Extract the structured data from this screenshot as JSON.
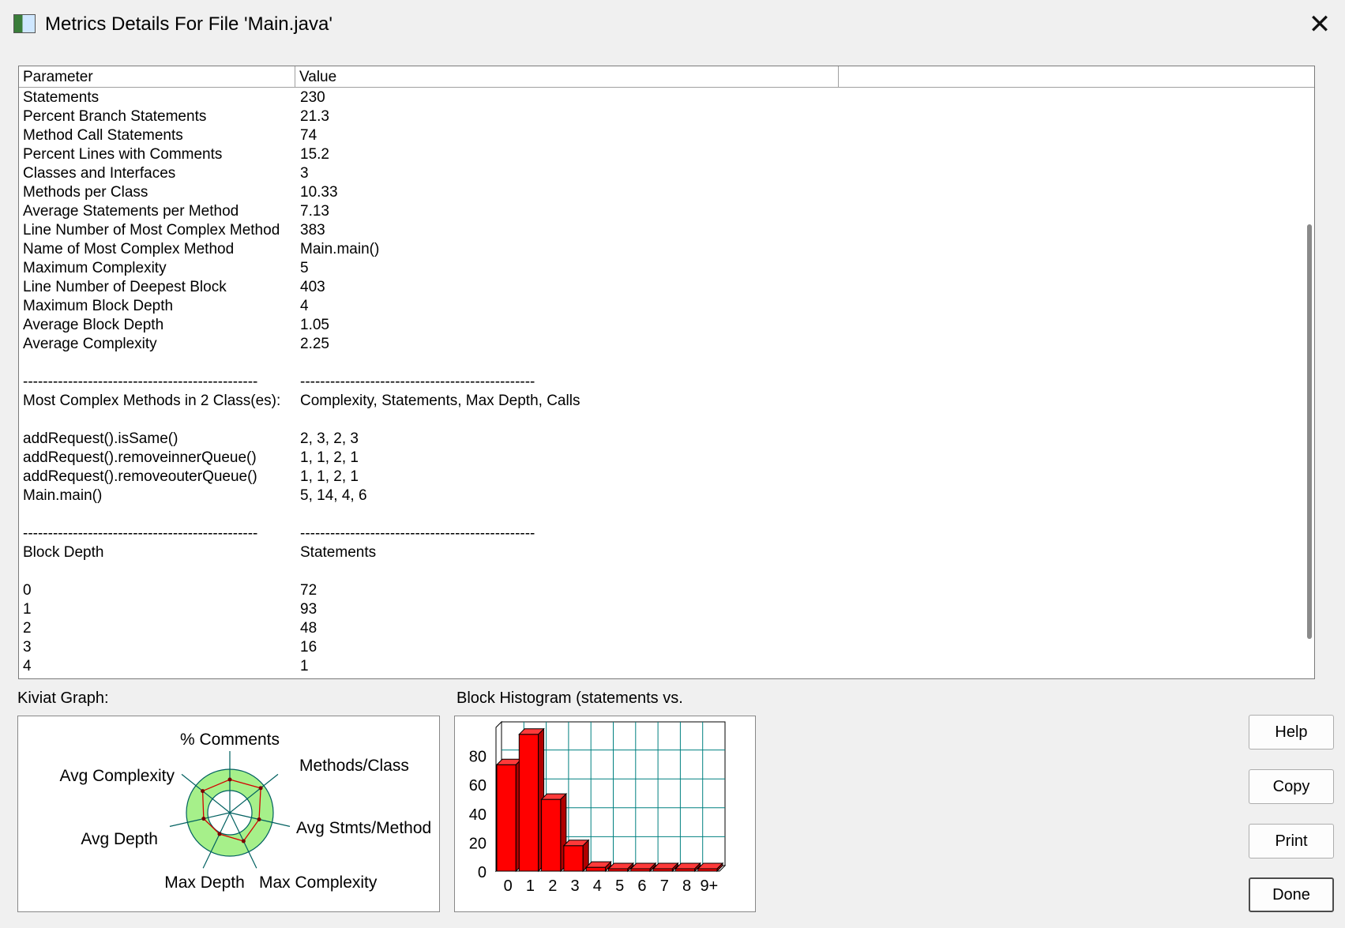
{
  "window": {
    "title": "Metrics Details For File 'Main.java'",
    "close_glyph": "✕"
  },
  "table": {
    "columns": [
      "Parameter",
      "Value",
      ""
    ],
    "rows": [
      [
        "Statements",
        "230"
      ],
      [
        "Percent Branch Statements",
        "21.3"
      ],
      [
        "Method Call Statements",
        "74"
      ],
      [
        "Percent Lines with Comments",
        "15.2"
      ],
      [
        "Classes and Interfaces",
        "3"
      ],
      [
        "Methods per Class",
        "10.33"
      ],
      [
        "Average Statements per Method",
        "7.13"
      ],
      [
        "Line Number of Most Complex Method",
        "383"
      ],
      [
        "Name of Most Complex Method",
        "Main.main()"
      ],
      [
        "Maximum Complexity",
        "5"
      ],
      [
        "Line Number of Deepest Block",
        "403"
      ],
      [
        "Maximum Block Depth",
        "4"
      ],
      [
        "Average Block Depth",
        "1.05"
      ],
      [
        "Average Complexity",
        "2.25"
      ],
      [
        "",
        ""
      ],
      [
        "-----------------------------------------------",
        "-----------------------------------------------"
      ],
      [
        "Most Complex Methods in 2 Class(es):",
        "Complexity, Statements, Max Depth, Calls"
      ],
      [
        "",
        ""
      ],
      [
        "addRequest().isSame()",
        "2, 3, 2, 3"
      ],
      [
        "addRequest().removeinnerQueue()",
        "1, 1, 2, 1"
      ],
      [
        "addRequest().removeouterQueue()",
        "1, 1, 2, 1"
      ],
      [
        "Main.main()",
        "5, 14, 4, 6"
      ],
      [
        "",
        ""
      ],
      [
        "-----------------------------------------------",
        "-----------------------------------------------"
      ],
      [
        "Block Depth",
        "Statements"
      ],
      [
        "",
        ""
      ],
      [
        "0",
        "72"
      ],
      [
        "1",
        "93"
      ],
      [
        "2",
        "48"
      ],
      [
        "3",
        "16"
      ],
      [
        "4",
        "1"
      ]
    ]
  },
  "kiviat": {
    "label": "Kiviat Graph:",
    "axes": [
      "% Comments",
      "Methods/Class",
      "Avg Stmts/Method",
      "Max Complexity",
      "Max Depth",
      "Avg Depth",
      "Avg Complexity"
    ],
    "ring_color": "#a6f08a",
    "polygon_color": "#d40000"
  },
  "histogram": {
    "label": "Block Histogram (statements vs.",
    "bar_color": "#ff0000",
    "grid_color": "#008080"
  },
  "chart_data": {
    "type": "bar",
    "categories": [
      "0",
      "1",
      "2",
      "3",
      "4",
      "5",
      "6",
      "7",
      "8",
      "9+"
    ],
    "values": [
      72,
      93,
      48,
      16,
      1,
      0,
      0,
      0,
      0,
      0
    ],
    "yticks": [
      "0",
      "20",
      "40",
      "60",
      "80"
    ],
    "ylim": [
      0,
      100
    ],
    "title": "",
    "xlabel": "",
    "ylabel": "",
    "grid": true
  },
  "buttons": {
    "help": "Help",
    "copy": "Copy",
    "print": "Print",
    "done": "Done"
  }
}
